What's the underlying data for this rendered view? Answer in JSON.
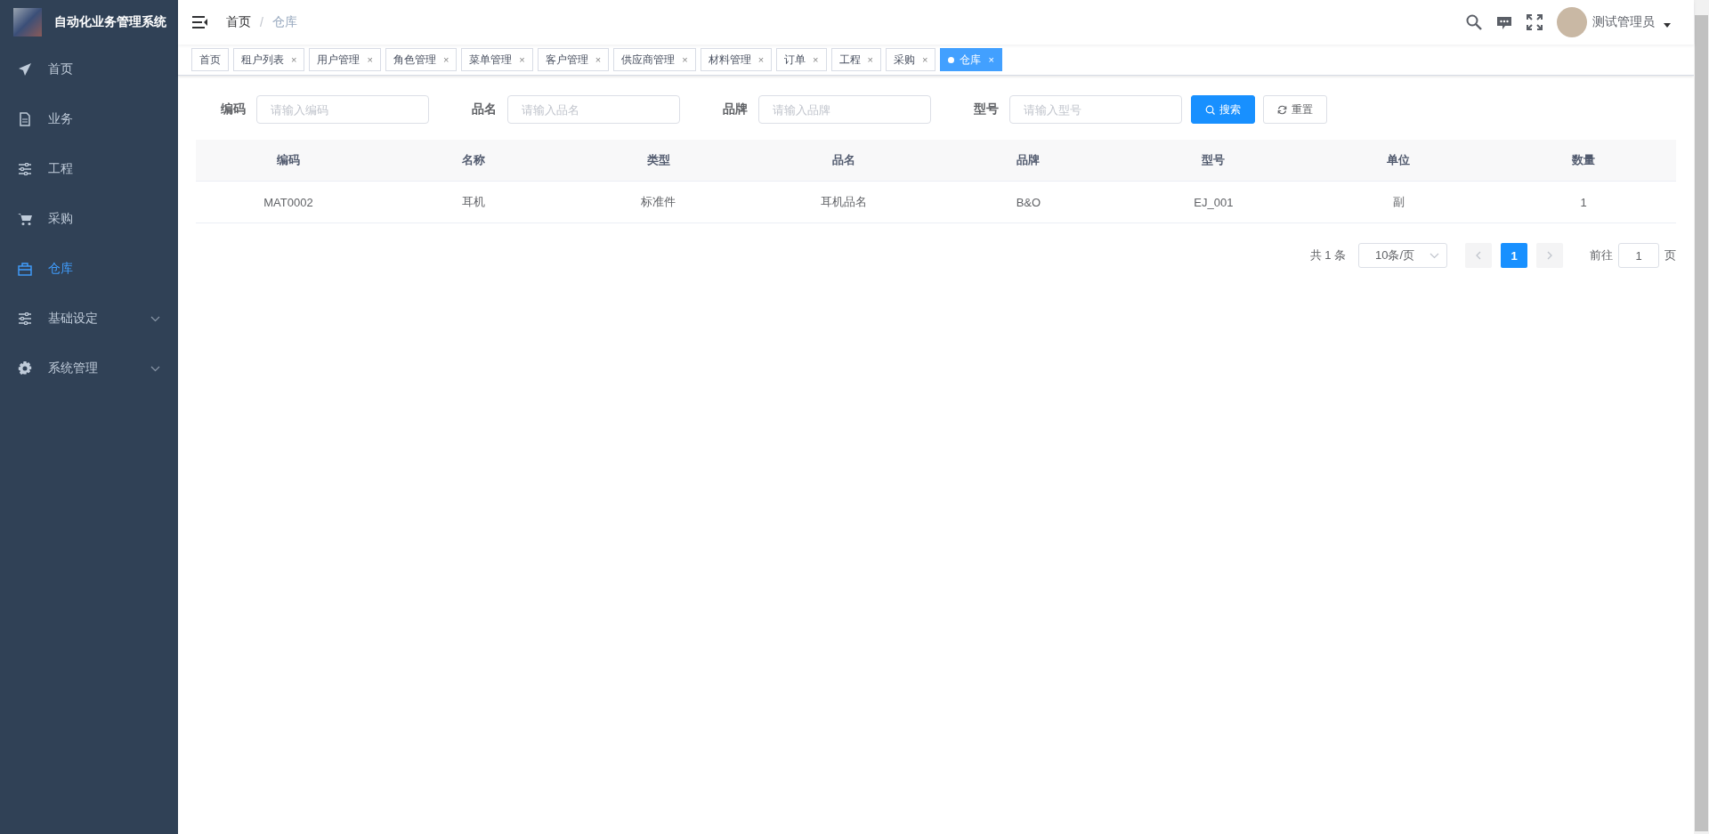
{
  "sidebar": {
    "title": "自动化业务管理系统",
    "items": [
      {
        "label": "首页",
        "kind": "send",
        "selected": false,
        "expandable": false
      },
      {
        "label": "业务",
        "kind": "document",
        "selected": false,
        "expandable": false
      },
      {
        "label": "工程",
        "kind": "sliders",
        "selected": false,
        "expandable": false
      },
      {
        "label": "采购",
        "kind": "cart",
        "selected": false,
        "expandable": false
      },
      {
        "label": "仓库",
        "kind": "briefcase",
        "selected": true,
        "expandable": false
      },
      {
        "label": "基础设定",
        "kind": "sliders",
        "selected": false,
        "expandable": true
      },
      {
        "label": "系统管理",
        "kind": "gear",
        "selected": false,
        "expandable": true
      }
    ]
  },
  "header": {
    "breadcrumb": [
      "首页",
      "仓库"
    ],
    "breadcrumb_separator": "/",
    "user": "测试管理员"
  },
  "tags": [
    {
      "label": "首页",
      "selected": false
    },
    {
      "label": "租户列表",
      "close": "×",
      "selected": false
    },
    {
      "label": "用户管理",
      "close": "×",
      "selected": false
    },
    {
      "label": "角色管理",
      "close": "×",
      "selected": false
    },
    {
      "label": "菜单管理",
      "close": "×",
      "selected": false
    },
    {
      "label": "客户管理",
      "close": "×",
      "selected": false
    },
    {
      "label": "供应商管理",
      "close": "×",
      "selected": false
    },
    {
      "label": "材料管理",
      "close": "×",
      "selected": false
    },
    {
      "label": "订单",
      "close": "×",
      "selected": false
    },
    {
      "label": "工程",
      "close": "×",
      "selected": false
    },
    {
      "label": "采购",
      "close": "×",
      "selected": false
    },
    {
      "label": "仓库",
      "close": "×",
      "selected": true
    }
  ],
  "search": {
    "fields": [
      {
        "label": "编码",
        "placeholder": "请输入编码"
      },
      {
        "label": "品名",
        "placeholder": "请输入品名"
      },
      {
        "label": "品牌",
        "placeholder": "请输入品牌"
      },
      {
        "label": "型号",
        "placeholder": "请输入型号"
      }
    ],
    "buttons": [
      {
        "label": "搜索",
        "kind": "primary"
      },
      {
        "label": "重置",
        "kind": "default"
      }
    ]
  },
  "table": {
    "columns": [
      "编码",
      "名称",
      "类型",
      "品名",
      "品牌",
      "型号",
      "单位",
      "数量"
    ],
    "rows": [
      [
        "MAT0002",
        "耳机",
        "标准件",
        "耳机品名",
        "B&O",
        "EJ_001",
        "副",
        "1"
      ]
    ]
  },
  "pagination": {
    "total": "共 1 条",
    "page_size": "10条/页",
    "pages": [
      {
        "label": "1",
        "selected": true
      }
    ],
    "goto_label": "前往",
    "goto_value": "1",
    "page_suffix": "页"
  }
}
